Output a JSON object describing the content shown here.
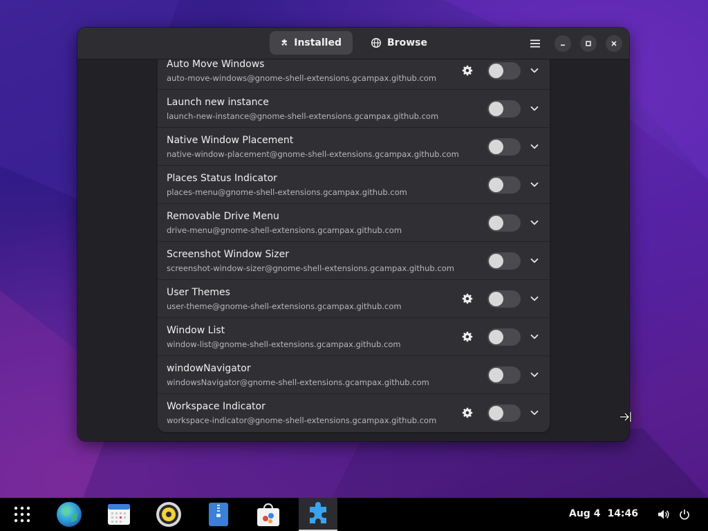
{
  "window": {
    "tabs": [
      {
        "label": "Installed",
        "icon": "puzzle-piece-icon",
        "active": true
      },
      {
        "label": "Browse",
        "icon": "globe-icon",
        "active": false
      }
    ],
    "controls": [
      "menu-icon",
      "minimize-icon",
      "maximize-icon",
      "close-icon"
    ]
  },
  "extensions": [
    {
      "name": "Auto Move Windows",
      "id": "auto-move-windows@gnome-shell-extensions.gcampax.github.com",
      "has_settings": true,
      "enabled": false
    },
    {
      "name": "Launch new instance",
      "id": "launch-new-instance@gnome-shell-extensions.gcampax.github.com",
      "has_settings": false,
      "enabled": false
    },
    {
      "name": "Native Window Placement",
      "id": "native-window-placement@gnome-shell-extensions.gcampax.github.com",
      "has_settings": false,
      "enabled": false
    },
    {
      "name": "Places Status Indicator",
      "id": "places-menu@gnome-shell-extensions.gcampax.github.com",
      "has_settings": false,
      "enabled": false
    },
    {
      "name": "Removable Drive Menu",
      "id": "drive-menu@gnome-shell-extensions.gcampax.github.com",
      "has_settings": false,
      "enabled": false
    },
    {
      "name": "Screenshot Window Sizer",
      "id": "screenshot-window-sizer@gnome-shell-extensions.gcampax.github.com",
      "has_settings": false,
      "enabled": false
    },
    {
      "name": "User Themes",
      "id": "user-theme@gnome-shell-extensions.gcampax.github.com",
      "has_settings": true,
      "enabled": false
    },
    {
      "name": "Window List",
      "id": "window-list@gnome-shell-extensions.gcampax.github.com",
      "has_settings": true,
      "enabled": false
    },
    {
      "name": "windowNavigator",
      "id": "windowsNavigator@gnome-shell-extensions.gcampax.github.com",
      "has_settings": false,
      "enabled": false
    },
    {
      "name": "Workspace Indicator",
      "id": "workspace-indicator@gnome-shell-extensions.gcampax.github.com",
      "has_settings": true,
      "enabled": false
    }
  ],
  "taskbar": {
    "apps": [
      {
        "name": "app-grid-icon",
        "active": false
      },
      {
        "name": "browser-globe-icon",
        "active": false
      },
      {
        "name": "calendar-icon",
        "active": false
      },
      {
        "name": "music-player-icon",
        "active": false
      },
      {
        "name": "file-archive-icon",
        "active": false
      },
      {
        "name": "software-store-icon",
        "active": false
      },
      {
        "name": "extensions-icon",
        "active": true
      }
    ],
    "date": "Aug 4",
    "time": "14:46",
    "status_icons": [
      "volume-icon",
      "power-icon"
    ]
  },
  "colors": {
    "window_bg": "#222226",
    "headerbar_bg": "#2e2e32",
    "row_bg": "#303034",
    "toggle_off": "#4a4a4f",
    "taskbar_bg": "#000000"
  }
}
